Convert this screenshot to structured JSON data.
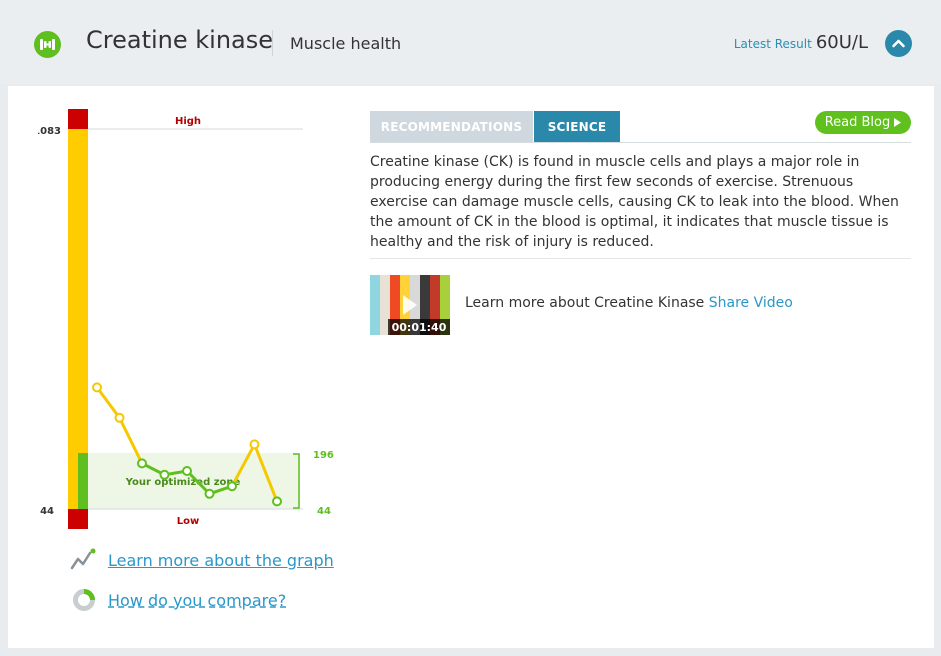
{
  "header": {
    "title": "Creatine kinase",
    "subtitle": "Muscle health",
    "latest_label": "Latest Result",
    "latest_value": "60U/L",
    "logo_icon": "dumbbell-icon",
    "collapse_icon": "chevron-up-icon"
  },
  "chart": {
    "high_label": "High",
    "low_label": "Low",
    "top_value": "1083",
    "bottom_value": "44",
    "zone_label": "Your optimized zone",
    "zone_top": "196",
    "zone_bottom": "44",
    "colors": {
      "high": "#cc0000",
      "yellow": "#ffcc00",
      "green": "#5fbf1e",
      "zone_bg": "#eef7e6"
    }
  },
  "chart_data": {
    "type": "line",
    "ylim": [
      44,
      1083
    ],
    "optimized_zone": [
      44,
      196
    ],
    "values_relative": [
      0.32,
      0.24,
      0.12,
      0.09,
      0.1,
      0.04,
      0.06,
      0.17,
      0.02
    ]
  },
  "links": {
    "graph": "Learn more about the graph",
    "compare": "How do you compare?"
  },
  "tabs": {
    "recommendations": "RECOMMENDATIONS",
    "science": "SCIENCE",
    "read_blog": "Read Blog"
  },
  "description": "Creatine kinase (CK) is found in muscle cells and plays a major role in producing energy during the first few seconds of exercise. Strenuous exercise can damage muscle cells, causing CK to leak into the blood. When the amount of CK in the blood is optimal, it indicates that muscle tissue is healthy and the risk of injury is reduced.",
  "video": {
    "duration": "00:01:40",
    "text": "Learn more about Creatine Kinase",
    "share": "Share Video"
  }
}
